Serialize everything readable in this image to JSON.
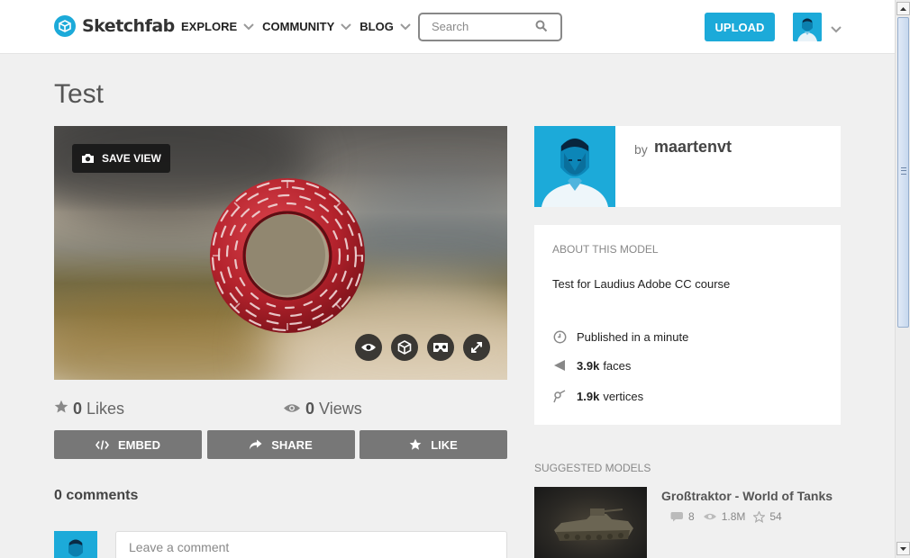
{
  "header": {
    "brand": "Sketchfab",
    "nav": [
      "EXPLORE",
      "COMMUNITY",
      "BLOG"
    ],
    "search_placeholder": "Search",
    "upload_label": "UPLOAD"
  },
  "model": {
    "title": "Test",
    "save_view_label": "SAVE VIEW",
    "likes_count": "0",
    "likes_label": "Likes",
    "views_count": "0",
    "views_label": "Views",
    "actions": [
      "EMBED",
      "SHARE",
      "LIKE"
    ]
  },
  "comments": {
    "heading": "0 comments",
    "placeholder": "Leave a comment"
  },
  "author": {
    "by": "by",
    "name": "maartenvt"
  },
  "about": {
    "heading": "ABOUT THIS MODEL",
    "description": "Test for Laudius Adobe CC course",
    "published": "Published in a minute",
    "faces_value": "3.9k",
    "faces_label": "faces",
    "vertices_value": "1.9k",
    "vertices_label": "vertices"
  },
  "suggested": {
    "heading": "SUGGESTED MODELS",
    "items": [
      {
        "title": "Großtraktor - World of Tanks",
        "comments": "8",
        "views": "1.8M",
        "likes": "54"
      }
    ]
  },
  "colors": {
    "accent": "#1caad9",
    "button_gray": "#777777",
    "torus_red": "#b3222c"
  }
}
